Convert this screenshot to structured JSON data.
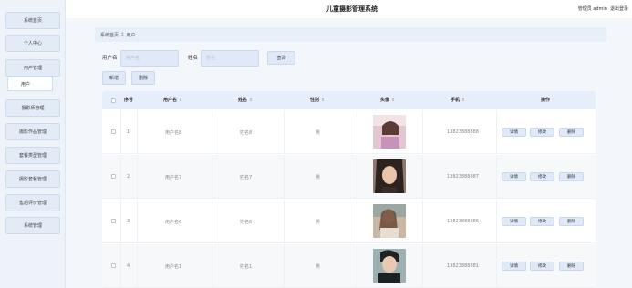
{
  "sidebar": {
    "items": [
      {
        "label": "系统首页"
      },
      {
        "label": "个人中心"
      },
      {
        "label": "用户管理"
      },
      {
        "label": "用户"
      },
      {
        "label": "摄影师管理"
      },
      {
        "label": "摄影作品管理"
      },
      {
        "label": "套餐类型管理"
      },
      {
        "label": "摄影套餐管理"
      },
      {
        "label": "售后评价管理"
      },
      {
        "label": "系统管理"
      }
    ]
  },
  "header": {
    "title": "儿童摄影管理系统",
    "user": "管理员 admin",
    "logout": "退出登录"
  },
  "breadcrumb": {
    "home": "系统首页",
    "sep": "‡",
    "current": "用户"
  },
  "search": {
    "username_label": "用户名",
    "username_placeholder": "用户名",
    "name_label": "姓名",
    "name_placeholder": "姓名",
    "search_button": "查询"
  },
  "toolbar": {
    "add": "新增",
    "delete": "删除"
  },
  "table": {
    "columns": {
      "index": "序号",
      "username": "用户名",
      "name": "姓名",
      "gender": "性别",
      "avatar": "头像",
      "phone": "手机",
      "actions": "操作"
    },
    "sort_glyph": "⇕",
    "rows": [
      {
        "index": "1",
        "username": "用户名8",
        "name": "姓名8",
        "gender": "男",
        "phone": "13823888888",
        "avatar_color": "#c9a9b3"
      },
      {
        "index": "2",
        "username": "用户名7",
        "name": "姓名7",
        "gender": "男",
        "phone": "13823888887",
        "avatar_color": "#4a3a34"
      },
      {
        "index": "3",
        "username": "用户名6",
        "name": "姓名6",
        "gender": "男",
        "phone": "13823888886",
        "avatar_color": "#b49a86"
      },
      {
        "index": "4",
        "username": "用户名1",
        "name": "姓名1",
        "gender": "男",
        "phone": "13823888881",
        "avatar_color": "#3d4748"
      }
    ],
    "actions": {
      "detail": "详情",
      "edit": "修改",
      "delete": "删除"
    }
  },
  "colors": {
    "accent": "#dfe9f7",
    "sidebar_bg": "#eef3fa"
  }
}
